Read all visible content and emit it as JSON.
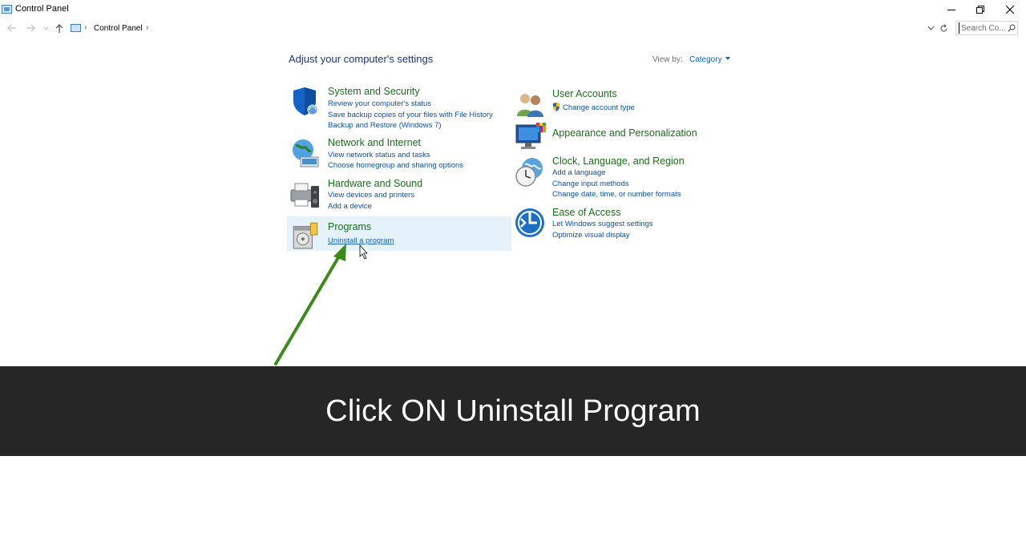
{
  "window": {
    "title": "Control Panel",
    "minimize_icon": "minimize-icon",
    "maximize_icon": "restore-icon",
    "close_icon": "close-icon"
  },
  "address": {
    "breadcrumb": "Control Panel",
    "search_placeholder": "Search Co..."
  },
  "content": {
    "heading": "Adjust your computer's settings",
    "view_by_label": "View by:",
    "view_by_value": "Category"
  },
  "categories": {
    "system": {
      "title": "System and Security",
      "links": [
        "Review your computer's status",
        "Save backup copies of your files with File History",
        "Backup and Restore (Windows 7)"
      ]
    },
    "network": {
      "title": "Network and Internet",
      "links": [
        "View network status and tasks",
        "Choose homegroup and sharing options"
      ]
    },
    "hardware": {
      "title": "Hardware and Sound",
      "links": [
        "View devices and printers",
        "Add a device"
      ]
    },
    "programs": {
      "title": "Programs",
      "links": [
        "Uninstall a program"
      ]
    },
    "users": {
      "title": "User Accounts",
      "links": [
        "Change account type"
      ]
    },
    "appearance": {
      "title": "Appearance and Personalization",
      "links": []
    },
    "clock": {
      "title": "Clock, Language, and Region",
      "links": [
        "Add a language",
        "Change input methods",
        "Change date, time, or number formats"
      ]
    },
    "ease": {
      "title": "Ease of Access",
      "links": [
        "Let Windows suggest settings",
        "Optimize visual display"
      ]
    }
  },
  "annotation": {
    "banner_text": "Click ON Uninstall Program",
    "arrow_color": "#3d8a1e"
  },
  "colors": {
    "category_title": "#1b6d1b",
    "link": "#0c52a6",
    "heading": "#1e3287",
    "banner_bg": "#262626"
  }
}
